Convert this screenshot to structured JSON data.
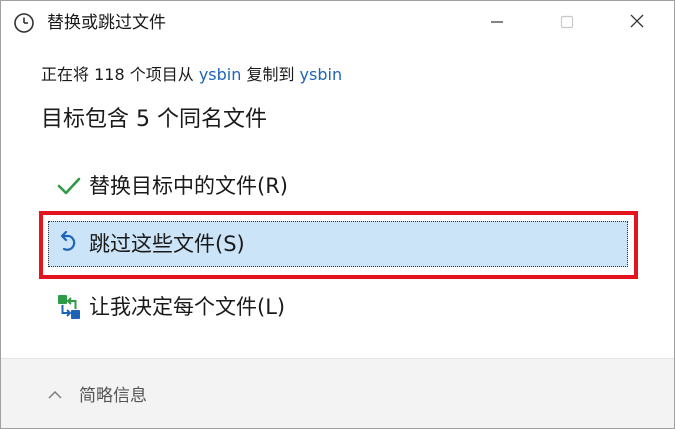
{
  "window": {
    "title": "替换或跳过文件",
    "title_icon": "clock-icon"
  },
  "titlebar_buttons": {
    "minimize": "minimize-icon",
    "maximize": "maximize-icon",
    "close": "close-icon"
  },
  "source": {
    "prefix": "正在将 118 个项目从 ",
    "from": "ysbin",
    "middle": " 复制到 ",
    "to": "ysbin"
  },
  "heading": "目标包含 5 个同名文件",
  "options": [
    {
      "label": "替换目标中的文件(R)",
      "icon": "checkmark-icon",
      "icon_color": "#2e9b46"
    },
    {
      "label": "跳过这些文件(S)",
      "icon": "skip-arrow-icon",
      "icon_color": "#1d64b8",
      "selected": true
    },
    {
      "label": "让我决定每个文件(L)",
      "icon": "compare-files-icon",
      "icon_color": "#1d64b8"
    }
  ],
  "footer": {
    "label": "简略信息",
    "icon": "chevron-up-icon"
  },
  "colors": {
    "link": "#1d64b8",
    "selection": "#cce4f7",
    "highlight_frame": "#e3141d"
  }
}
